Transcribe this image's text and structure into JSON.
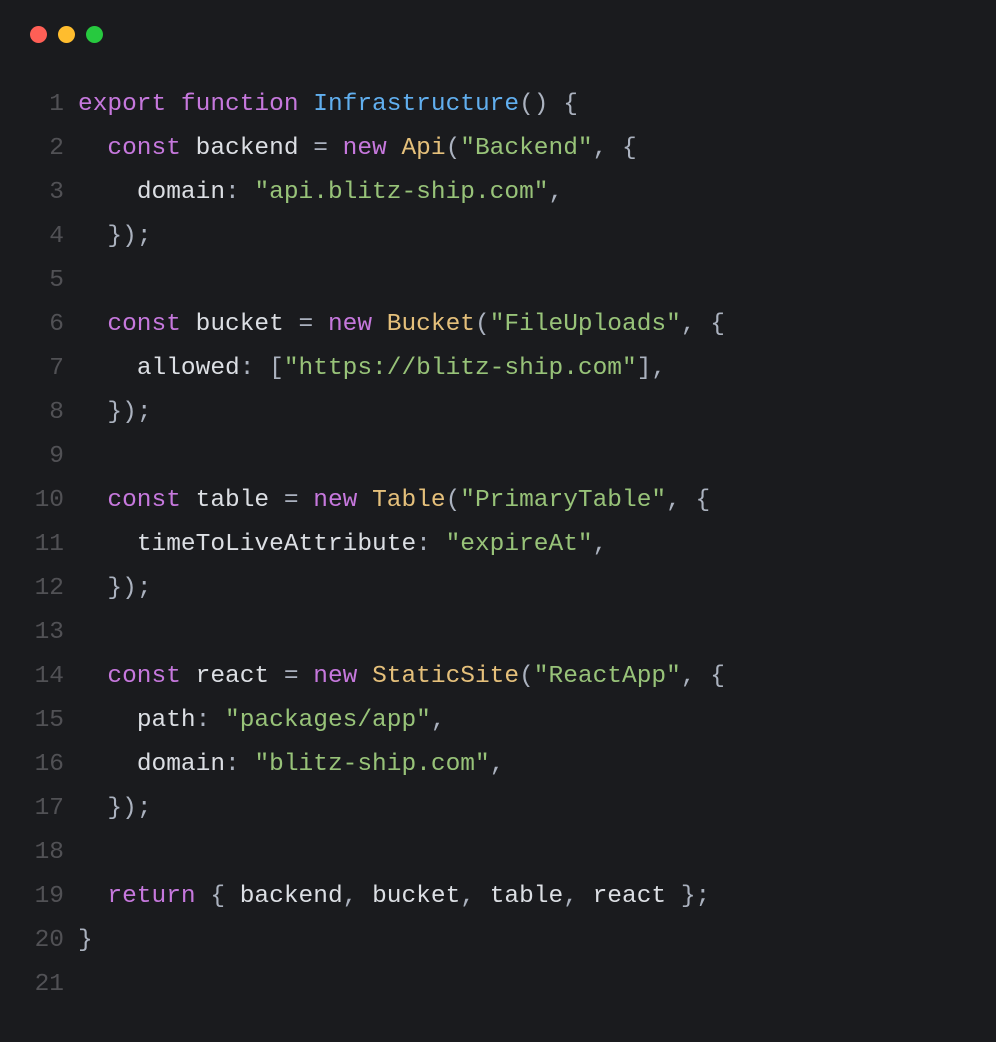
{
  "window": {
    "controls": {
      "close_color": "#ff5f56",
      "minimize_color": "#ffbd2e",
      "zoom_color": "#27c93f"
    }
  },
  "code": {
    "language": "typescript",
    "lines": [
      {
        "n": "1",
        "tokens": [
          {
            "t": "export",
            "c": "kw-export"
          },
          {
            "t": " "
          },
          {
            "t": "function",
            "c": "kw-func"
          },
          {
            "t": " "
          },
          {
            "t": "Infrastructure",
            "c": "fn-name"
          },
          {
            "t": "(",
            "c": "paren"
          },
          {
            "t": ")",
            "c": "paren"
          },
          {
            "t": " "
          },
          {
            "t": "{",
            "c": "brace"
          }
        ]
      },
      {
        "n": "2",
        "tokens": [
          {
            "t": "  "
          },
          {
            "t": "const",
            "c": "kw-const"
          },
          {
            "t": " "
          },
          {
            "t": "backend",
            "c": "var-name"
          },
          {
            "t": " "
          },
          {
            "t": "=",
            "c": "op"
          },
          {
            "t": " "
          },
          {
            "t": "new",
            "c": "kw-new"
          },
          {
            "t": " "
          },
          {
            "t": "Api",
            "c": "class-name"
          },
          {
            "t": "(",
            "c": "paren"
          },
          {
            "t": "\"Backend\"",
            "c": "string"
          },
          {
            "t": ",",
            "c": "comma"
          },
          {
            "t": " "
          },
          {
            "t": "{",
            "c": "brace"
          }
        ]
      },
      {
        "n": "3",
        "tokens": [
          {
            "t": "    "
          },
          {
            "t": "domain",
            "c": "prop"
          },
          {
            "t": ":",
            "c": "colon"
          },
          {
            "t": " "
          },
          {
            "t": "\"api.blitz-ship.com\"",
            "c": "string"
          },
          {
            "t": ",",
            "c": "comma"
          }
        ]
      },
      {
        "n": "4",
        "tokens": [
          {
            "t": "  "
          },
          {
            "t": "}",
            "c": "brace"
          },
          {
            "t": ")",
            "c": "paren"
          },
          {
            "t": ";",
            "c": "semi"
          }
        ]
      },
      {
        "n": "5",
        "tokens": []
      },
      {
        "n": "6",
        "tokens": [
          {
            "t": "  "
          },
          {
            "t": "const",
            "c": "kw-const"
          },
          {
            "t": " "
          },
          {
            "t": "bucket",
            "c": "var-name"
          },
          {
            "t": " "
          },
          {
            "t": "=",
            "c": "op"
          },
          {
            "t": " "
          },
          {
            "t": "new",
            "c": "kw-new"
          },
          {
            "t": " "
          },
          {
            "t": "Bucket",
            "c": "class-name"
          },
          {
            "t": "(",
            "c": "paren"
          },
          {
            "t": "\"FileUploads\"",
            "c": "string"
          },
          {
            "t": ",",
            "c": "comma"
          },
          {
            "t": " "
          },
          {
            "t": "{",
            "c": "brace"
          }
        ]
      },
      {
        "n": "7",
        "tokens": [
          {
            "t": "    "
          },
          {
            "t": "allowed",
            "c": "prop"
          },
          {
            "t": ":",
            "c": "colon"
          },
          {
            "t": " "
          },
          {
            "t": "[",
            "c": "bracket"
          },
          {
            "t": "\"https://blitz-ship.com\"",
            "c": "string"
          },
          {
            "t": "]",
            "c": "bracket"
          },
          {
            "t": ",",
            "c": "comma"
          }
        ]
      },
      {
        "n": "8",
        "tokens": [
          {
            "t": "  "
          },
          {
            "t": "}",
            "c": "brace"
          },
          {
            "t": ")",
            "c": "paren"
          },
          {
            "t": ";",
            "c": "semi"
          }
        ]
      },
      {
        "n": "9",
        "tokens": []
      },
      {
        "n": "10",
        "tokens": [
          {
            "t": "  "
          },
          {
            "t": "const",
            "c": "kw-const"
          },
          {
            "t": " "
          },
          {
            "t": "table",
            "c": "var-name"
          },
          {
            "t": " "
          },
          {
            "t": "=",
            "c": "op"
          },
          {
            "t": " "
          },
          {
            "t": "new",
            "c": "kw-new"
          },
          {
            "t": " "
          },
          {
            "t": "Table",
            "c": "class-name"
          },
          {
            "t": "(",
            "c": "paren"
          },
          {
            "t": "\"PrimaryTable\"",
            "c": "string"
          },
          {
            "t": ",",
            "c": "comma"
          },
          {
            "t": " "
          },
          {
            "t": "{",
            "c": "brace"
          }
        ]
      },
      {
        "n": "11",
        "tokens": [
          {
            "t": "    "
          },
          {
            "t": "timeToLiveAttribute",
            "c": "prop"
          },
          {
            "t": ":",
            "c": "colon"
          },
          {
            "t": " "
          },
          {
            "t": "\"expireAt\"",
            "c": "string"
          },
          {
            "t": ",",
            "c": "comma"
          }
        ]
      },
      {
        "n": "12",
        "tokens": [
          {
            "t": "  "
          },
          {
            "t": "}",
            "c": "brace"
          },
          {
            "t": ")",
            "c": "paren"
          },
          {
            "t": ";",
            "c": "semi"
          }
        ]
      },
      {
        "n": "13",
        "tokens": []
      },
      {
        "n": "14",
        "tokens": [
          {
            "t": "  "
          },
          {
            "t": "const",
            "c": "kw-const"
          },
          {
            "t": " "
          },
          {
            "t": "react",
            "c": "var-name"
          },
          {
            "t": " "
          },
          {
            "t": "=",
            "c": "op"
          },
          {
            "t": " "
          },
          {
            "t": "new",
            "c": "kw-new"
          },
          {
            "t": " "
          },
          {
            "t": "StaticSite",
            "c": "class-name"
          },
          {
            "t": "(",
            "c": "paren"
          },
          {
            "t": "\"ReactApp\"",
            "c": "string"
          },
          {
            "t": ",",
            "c": "comma"
          },
          {
            "t": " "
          },
          {
            "t": "{",
            "c": "brace"
          }
        ]
      },
      {
        "n": "15",
        "tokens": [
          {
            "t": "    "
          },
          {
            "t": "path",
            "c": "prop"
          },
          {
            "t": ":",
            "c": "colon"
          },
          {
            "t": " "
          },
          {
            "t": "\"packages/app\"",
            "c": "string"
          },
          {
            "t": ",",
            "c": "comma"
          }
        ]
      },
      {
        "n": "16",
        "tokens": [
          {
            "t": "    "
          },
          {
            "t": "domain",
            "c": "prop"
          },
          {
            "t": ":",
            "c": "colon"
          },
          {
            "t": " "
          },
          {
            "t": "\"blitz-ship.com\"",
            "c": "string"
          },
          {
            "t": ",",
            "c": "comma"
          }
        ]
      },
      {
        "n": "17",
        "tokens": [
          {
            "t": "  "
          },
          {
            "t": "}",
            "c": "brace"
          },
          {
            "t": ")",
            "c": "paren"
          },
          {
            "t": ";",
            "c": "semi"
          }
        ]
      },
      {
        "n": "18",
        "tokens": []
      },
      {
        "n": "19",
        "tokens": [
          {
            "t": "  "
          },
          {
            "t": "return",
            "c": "kw-return"
          },
          {
            "t": " "
          },
          {
            "t": "{",
            "c": "brace"
          },
          {
            "t": " "
          },
          {
            "t": "backend",
            "c": "var-name"
          },
          {
            "t": ",",
            "c": "comma"
          },
          {
            "t": " "
          },
          {
            "t": "bucket",
            "c": "var-name"
          },
          {
            "t": ",",
            "c": "comma"
          },
          {
            "t": " "
          },
          {
            "t": "table",
            "c": "var-name"
          },
          {
            "t": ",",
            "c": "comma"
          },
          {
            "t": " "
          },
          {
            "t": "react",
            "c": "var-name"
          },
          {
            "t": " "
          },
          {
            "t": "}",
            "c": "brace"
          },
          {
            "t": ";",
            "c": "semi"
          }
        ]
      },
      {
        "n": "20",
        "tokens": [
          {
            "t": "}",
            "c": "brace"
          }
        ]
      },
      {
        "n": "21",
        "tokens": []
      }
    ]
  }
}
